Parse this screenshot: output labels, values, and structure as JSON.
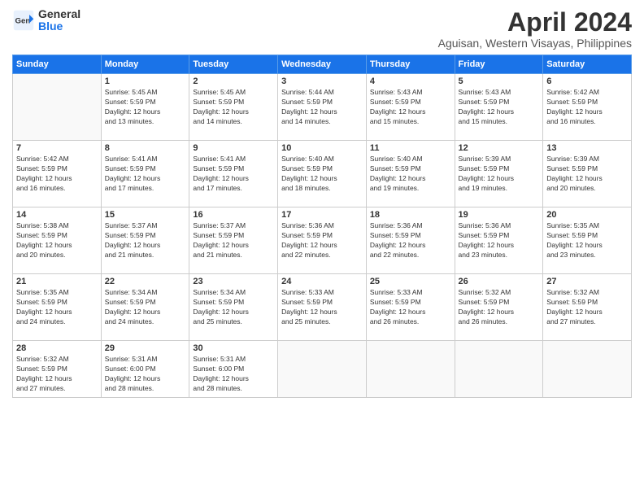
{
  "header": {
    "logo_general": "General",
    "logo_blue": "Blue",
    "month_title": "April 2024",
    "location": "Aguisan, Western Visayas, Philippines"
  },
  "days_of_week": [
    "Sunday",
    "Monday",
    "Tuesday",
    "Wednesday",
    "Thursday",
    "Friday",
    "Saturday"
  ],
  "weeks": [
    [
      {
        "day": "",
        "info": ""
      },
      {
        "day": "1",
        "info": "Sunrise: 5:45 AM\nSunset: 5:59 PM\nDaylight: 12 hours\nand 13 minutes."
      },
      {
        "day": "2",
        "info": "Sunrise: 5:45 AM\nSunset: 5:59 PM\nDaylight: 12 hours\nand 14 minutes."
      },
      {
        "day": "3",
        "info": "Sunrise: 5:44 AM\nSunset: 5:59 PM\nDaylight: 12 hours\nand 14 minutes."
      },
      {
        "day": "4",
        "info": "Sunrise: 5:43 AM\nSunset: 5:59 PM\nDaylight: 12 hours\nand 15 minutes."
      },
      {
        "day": "5",
        "info": "Sunrise: 5:43 AM\nSunset: 5:59 PM\nDaylight: 12 hours\nand 15 minutes."
      },
      {
        "day": "6",
        "info": "Sunrise: 5:42 AM\nSunset: 5:59 PM\nDaylight: 12 hours\nand 16 minutes."
      }
    ],
    [
      {
        "day": "7",
        "info": "Sunrise: 5:42 AM\nSunset: 5:59 PM\nDaylight: 12 hours\nand 16 minutes."
      },
      {
        "day": "8",
        "info": "Sunrise: 5:41 AM\nSunset: 5:59 PM\nDaylight: 12 hours\nand 17 minutes."
      },
      {
        "day": "9",
        "info": "Sunrise: 5:41 AM\nSunset: 5:59 PM\nDaylight: 12 hours\nand 17 minutes."
      },
      {
        "day": "10",
        "info": "Sunrise: 5:40 AM\nSunset: 5:59 PM\nDaylight: 12 hours\nand 18 minutes."
      },
      {
        "day": "11",
        "info": "Sunrise: 5:40 AM\nSunset: 5:59 PM\nDaylight: 12 hours\nand 19 minutes."
      },
      {
        "day": "12",
        "info": "Sunrise: 5:39 AM\nSunset: 5:59 PM\nDaylight: 12 hours\nand 19 minutes."
      },
      {
        "day": "13",
        "info": "Sunrise: 5:39 AM\nSunset: 5:59 PM\nDaylight: 12 hours\nand 20 minutes."
      }
    ],
    [
      {
        "day": "14",
        "info": "Sunrise: 5:38 AM\nSunset: 5:59 PM\nDaylight: 12 hours\nand 20 minutes."
      },
      {
        "day": "15",
        "info": "Sunrise: 5:37 AM\nSunset: 5:59 PM\nDaylight: 12 hours\nand 21 minutes."
      },
      {
        "day": "16",
        "info": "Sunrise: 5:37 AM\nSunset: 5:59 PM\nDaylight: 12 hours\nand 21 minutes."
      },
      {
        "day": "17",
        "info": "Sunrise: 5:36 AM\nSunset: 5:59 PM\nDaylight: 12 hours\nand 22 minutes."
      },
      {
        "day": "18",
        "info": "Sunrise: 5:36 AM\nSunset: 5:59 PM\nDaylight: 12 hours\nand 22 minutes."
      },
      {
        "day": "19",
        "info": "Sunrise: 5:36 AM\nSunset: 5:59 PM\nDaylight: 12 hours\nand 23 minutes."
      },
      {
        "day": "20",
        "info": "Sunrise: 5:35 AM\nSunset: 5:59 PM\nDaylight: 12 hours\nand 23 minutes."
      }
    ],
    [
      {
        "day": "21",
        "info": "Sunrise: 5:35 AM\nSunset: 5:59 PM\nDaylight: 12 hours\nand 24 minutes."
      },
      {
        "day": "22",
        "info": "Sunrise: 5:34 AM\nSunset: 5:59 PM\nDaylight: 12 hours\nand 24 minutes."
      },
      {
        "day": "23",
        "info": "Sunrise: 5:34 AM\nSunset: 5:59 PM\nDaylight: 12 hours\nand 25 minutes."
      },
      {
        "day": "24",
        "info": "Sunrise: 5:33 AM\nSunset: 5:59 PM\nDaylight: 12 hours\nand 25 minutes."
      },
      {
        "day": "25",
        "info": "Sunrise: 5:33 AM\nSunset: 5:59 PM\nDaylight: 12 hours\nand 26 minutes."
      },
      {
        "day": "26",
        "info": "Sunrise: 5:32 AM\nSunset: 5:59 PM\nDaylight: 12 hours\nand 26 minutes."
      },
      {
        "day": "27",
        "info": "Sunrise: 5:32 AM\nSunset: 5:59 PM\nDaylight: 12 hours\nand 27 minutes."
      }
    ],
    [
      {
        "day": "28",
        "info": "Sunrise: 5:32 AM\nSunset: 5:59 PM\nDaylight: 12 hours\nand 27 minutes."
      },
      {
        "day": "29",
        "info": "Sunrise: 5:31 AM\nSunset: 6:00 PM\nDaylight: 12 hours\nand 28 minutes."
      },
      {
        "day": "30",
        "info": "Sunrise: 5:31 AM\nSunset: 6:00 PM\nDaylight: 12 hours\nand 28 minutes."
      },
      {
        "day": "",
        "info": ""
      },
      {
        "day": "",
        "info": ""
      },
      {
        "day": "",
        "info": ""
      },
      {
        "day": "",
        "info": ""
      }
    ]
  ]
}
